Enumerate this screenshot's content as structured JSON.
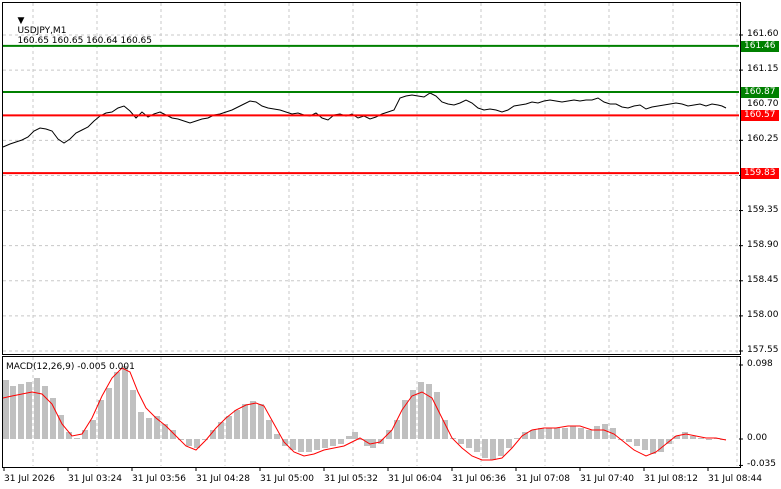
{
  "header": {
    "triangle": "▼",
    "symbol": "USDJPY,M1",
    "ohlc": "160.65 160.65 160.64 160.65"
  },
  "macd_header": {
    "label": "MACD(12,26,9) -0.005 0.001"
  },
  "price_axis": [
    "161.60",
    "161.15",
    "160.25",
    "159.80",
    "159.35",
    "158.90",
    "158.45",
    "158.00",
    "157.55"
  ],
  "price_axis_partial": "160.70",
  "levels": [
    {
      "value": "161.46",
      "color": "#008000"
    },
    {
      "value": "160.87",
      "color": "#008000"
    },
    {
      "value": "160.57",
      "color": "#ff0000"
    },
    {
      "value": "159.83",
      "color": "#ff0000"
    }
  ],
  "current_price": "160.65",
  "macd_axis": [
    "0.098",
    "0.00",
    "-0.035"
  ],
  "time_axis": [
    "31 Jul 2026",
    "31 Jul 03:24",
    "31 Jul 03:56",
    "31 Jul 04:28",
    "31 Jul 05:00",
    "31 Jul 05:32",
    "31 Jul 06:04",
    "31 Jul 06:36",
    "31 Jul 07:08",
    "31 Jul 07:40",
    "31 Jul 08:12",
    "31 Jul 08:44"
  ],
  "colors": {
    "green_level": "#008000",
    "red_level": "#ff0000",
    "histogram": "#c0c0c0",
    "signal": "#ff0000",
    "grid": "#c8c8c8"
  }
}
